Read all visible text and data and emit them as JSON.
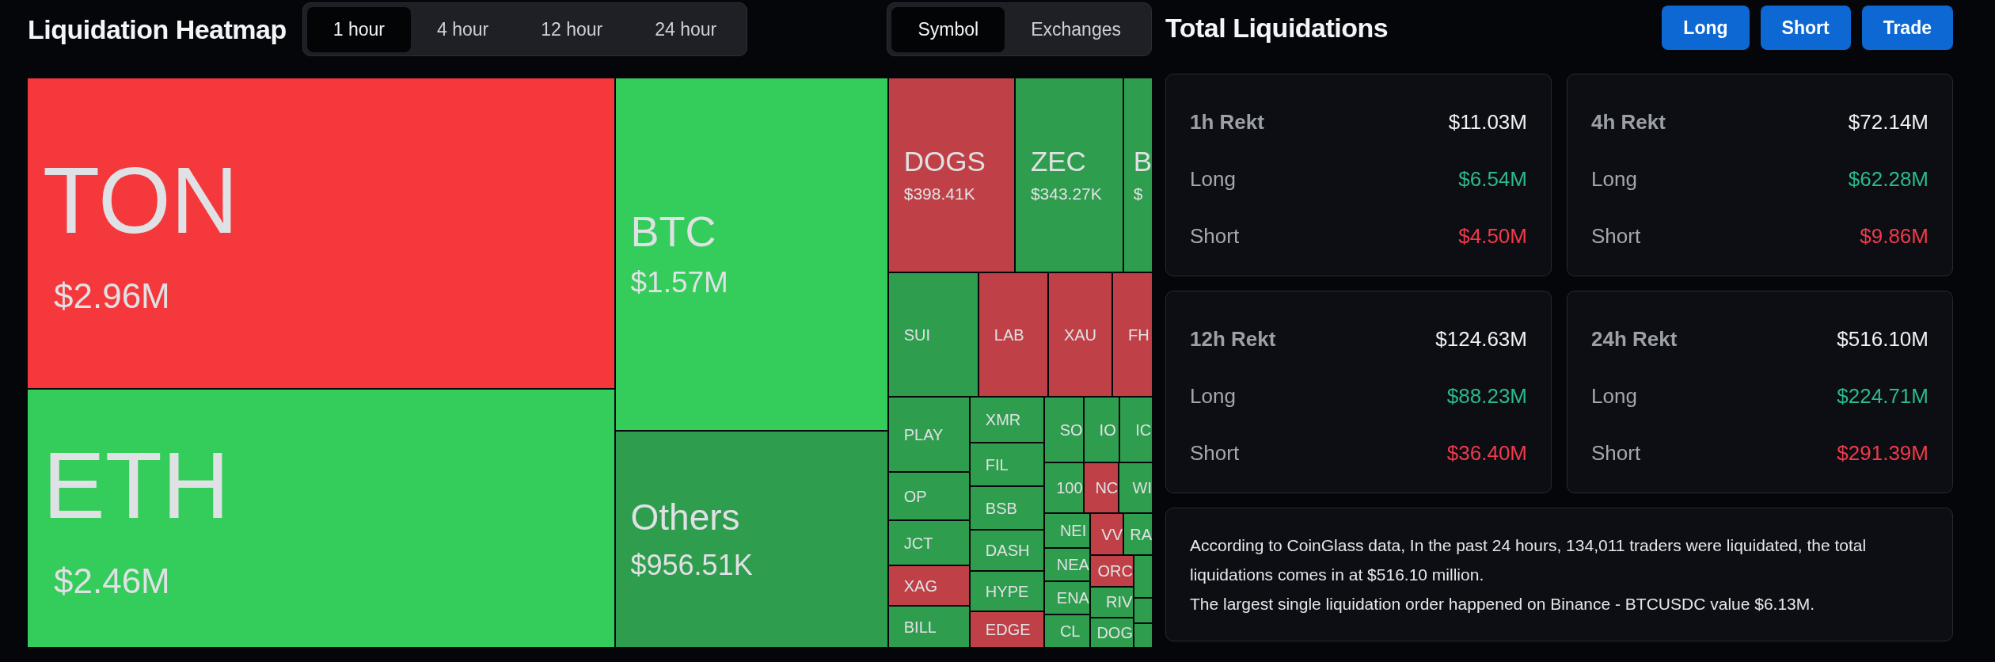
{
  "heatmap": {
    "title": "Liquidation Heatmap",
    "timeframes": [
      {
        "label": "1 hour",
        "selected": true
      },
      {
        "label": "4 hour",
        "selected": false
      },
      {
        "label": "12 hour",
        "selected": false
      },
      {
        "label": "24 hour",
        "selected": false
      }
    ],
    "groupings": [
      {
        "label": "Symbol",
        "selected": true
      },
      {
        "label": "Exchanges",
        "selected": false
      }
    ],
    "tiles": [
      {
        "symbol": "TON",
        "value": "$2.96M",
        "color": "#f5383c"
      },
      {
        "symbol": "ETH",
        "value": "$2.46M",
        "color": "#34cc5b"
      },
      {
        "symbol": "BTC",
        "value": "$1.57M",
        "color": "#34cc5b"
      },
      {
        "symbol": "Others",
        "value": "$956.51K",
        "color": "#2f9d4e"
      },
      {
        "symbol": "DOGS",
        "value": "$398.41K",
        "color": "#bf4147"
      },
      {
        "symbol": "ZEC",
        "value": "$343.27K",
        "color": "#2f9d4e"
      },
      {
        "symbol": "B",
        "value": "$",
        "color": "#2f9d4e"
      },
      {
        "symbol": "SUI",
        "color": "#2f9d4e"
      },
      {
        "symbol": "LAB",
        "color": "#bf4147"
      },
      {
        "symbol": "XAU",
        "color": "#bf4147"
      },
      {
        "symbol": "FH",
        "color": "#bf4147"
      },
      {
        "symbol": "PLAY",
        "color": "#2f9d4e"
      },
      {
        "symbol": "OP",
        "color": "#2f9d4e"
      },
      {
        "symbol": "JCT",
        "color": "#2f9d4e"
      },
      {
        "symbol": "XAG",
        "color": "#bf4147"
      },
      {
        "symbol": "BILL",
        "color": "#2f9d4e"
      },
      {
        "symbol": "XMR",
        "color": "#2f9d4e"
      },
      {
        "symbol": "FIL",
        "color": "#2f9d4e"
      },
      {
        "symbol": "BSB",
        "color": "#2f9d4e"
      },
      {
        "symbol": "DASH",
        "color": "#2f9d4e"
      },
      {
        "symbol": "HYPE",
        "color": "#2f9d4e"
      },
      {
        "symbol": "EDGE",
        "color": "#bf4147"
      },
      {
        "symbol": "SO",
        "color": "#2f9d4e"
      },
      {
        "symbol": "IO",
        "color": "#2f9d4e"
      },
      {
        "symbol": "IC",
        "color": "#2f9d4e"
      },
      {
        "symbol": "100",
        "color": "#2f9d4e"
      },
      {
        "symbol": "NC",
        "color": "#bf4147"
      },
      {
        "symbol": "WI",
        "color": "#2f9d4e"
      },
      {
        "symbol": "NEI",
        "color": "#2f9d4e"
      },
      {
        "symbol": "NEA",
        "color": "#2f9d4e"
      },
      {
        "symbol": "ENA",
        "color": "#2f9d4e"
      },
      {
        "symbol": "CL",
        "color": "#2f9d4e"
      },
      {
        "symbol": "VV",
        "color": "#bf4147"
      },
      {
        "symbol": "RA",
        "color": "#2f9d4e"
      },
      {
        "symbol": "ORC",
        "color": "#bf4147"
      },
      {
        "symbol": "RIV",
        "color": "#2f9d4e"
      },
      {
        "symbol": "DOG",
        "color": "#2f9d4e"
      },
      {
        "color": "#2f9d4e"
      },
      {
        "color": "#2f9d4e"
      },
      {
        "color": "#2f9d4e"
      }
    ]
  },
  "liquidations": {
    "title": "Total Liquidations",
    "buttons": [
      "Long",
      "Short",
      "Trade"
    ],
    "cards": [
      {
        "rows": [
          {
            "kind": "total",
            "label": "1h Rekt",
            "value": "$11.03M"
          },
          {
            "kind": "long",
            "label": "Long",
            "value": "$6.54M"
          },
          {
            "kind": "short",
            "label": "Short",
            "value": "$4.50M"
          }
        ]
      },
      {
        "rows": [
          {
            "kind": "total",
            "label": "4h Rekt",
            "value": "$72.14M"
          },
          {
            "kind": "long",
            "label": "Long",
            "value": "$62.28M"
          },
          {
            "kind": "short",
            "label": "Short",
            "value": "$9.86M"
          }
        ]
      },
      {
        "rows": [
          {
            "kind": "total",
            "label": "12h Rekt",
            "value": "$124.63M"
          },
          {
            "kind": "long",
            "label": "Long",
            "value": "$88.23M"
          },
          {
            "kind": "short",
            "label": "Short",
            "value": "$36.40M"
          }
        ]
      },
      {
        "rows": [
          {
            "kind": "total",
            "label": "24h Rekt",
            "value": "$516.10M"
          },
          {
            "kind": "long",
            "label": "Long",
            "value": "$224.71M"
          },
          {
            "kind": "short",
            "label": "Short",
            "value": "$291.39M"
          }
        ]
      }
    ],
    "summary": [
      "According to CoinGlass data, In the past 24 hours, 134,011 traders were liquidated, the total liquidations comes in at $516.10 million.",
      "The largest single liquidation order happened on Binance - BTCUSDC value $6.13M."
    ]
  }
}
